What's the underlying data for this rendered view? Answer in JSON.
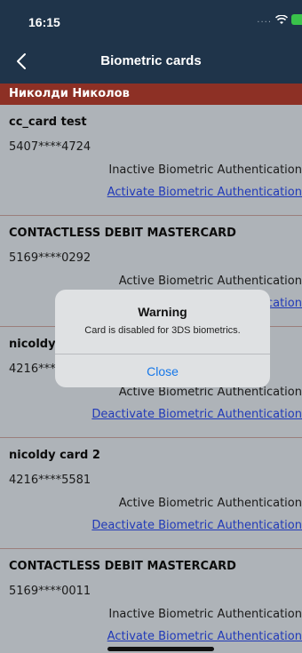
{
  "status_bar": {
    "time": "16:15",
    "signal_dots": "....",
    "icons": [
      "wifi-icon",
      "battery-charging-icon"
    ]
  },
  "nav": {
    "back_icon": "chevron-left-icon",
    "title": "Biometric cards"
  },
  "owner": {
    "name": "Николди Николов"
  },
  "cards": [
    {
      "name": "cc_card test",
      "number": "5407****4724",
      "status": "Inactive Biometric Authentication",
      "action": "Activate Biometric Authentication"
    },
    {
      "name": "CONTACTLESS DEBIT MASTERCARD",
      "number": "5169****0292",
      "status": "Active Biometric Authentication",
      "action": "Deactivate Biometric Authentication"
    },
    {
      "name": "nicoldy card 1",
      "number": "4216****",
      "status": "Active Biometric Authentication",
      "action": "Deactivate Biometric Authentication"
    },
    {
      "name": "nicoldy card 2",
      "number": "4216****5581",
      "status": "Active Biometric Authentication",
      "action": "Deactivate Biometric Authentication"
    },
    {
      "name": "CONTACTLESS DEBIT MASTERCARD",
      "number": "5169****0011",
      "status": "Inactive Biometric Authentication",
      "action": "Activate Biometric Authentication"
    }
  ],
  "alert": {
    "title": "Warning",
    "message": "Card is disabled for 3DS biometrics.",
    "close_label": "Close"
  },
  "colors": {
    "nav": "#1f344a",
    "owner_bar": "#8d3025",
    "link": "#2039b8",
    "alert_button": "#1677e8"
  }
}
